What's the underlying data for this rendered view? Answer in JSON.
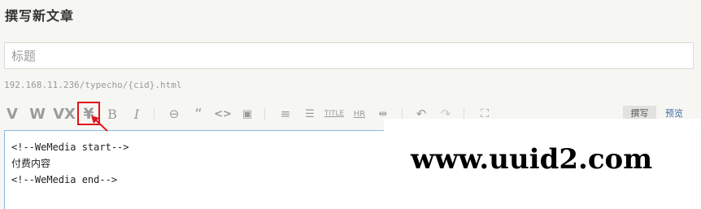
{
  "page": {
    "title": "撰写新文章"
  },
  "title_field": {
    "placeholder": "标题",
    "value": ""
  },
  "permalink": "192.168.11.236/typecho/{cid}.html",
  "toolbar": {
    "buttons": [
      {
        "glyph": "V",
        "icon": "v-plugin-icon"
      },
      {
        "glyph": "W",
        "icon": "w-plugin-icon"
      },
      {
        "glyph": "VX",
        "icon": "vx-plugin-icon"
      },
      {
        "glyph": "¥",
        "icon": "yuan-paid-content-icon"
      },
      {
        "glyph": "B",
        "icon": "bold-icon"
      },
      {
        "glyph": "I",
        "icon": "italic-icon"
      },
      {
        "glyph": "⊖",
        "icon": "link-icon"
      },
      {
        "glyph": "“",
        "icon": "quote-icon"
      },
      {
        "glyph": "<>",
        "icon": "code-icon"
      },
      {
        "glyph": "▣",
        "icon": "image-icon"
      },
      {
        "glyph": "≡",
        "icon": "ordered-list-icon"
      },
      {
        "glyph": "☰",
        "icon": "unordered-list-icon"
      },
      {
        "glyph": "TITLE",
        "icon": "heading-icon"
      },
      {
        "glyph": "HR",
        "icon": "horizontal-rule-icon"
      },
      {
        "glyph": "⇹",
        "icon": "more-separator-icon"
      },
      {
        "glyph": "↶",
        "icon": "undo-icon"
      },
      {
        "glyph": "↷",
        "icon": "redo-icon"
      },
      {
        "glyph": "⛶",
        "icon": "fullscreen-icon"
      }
    ],
    "tab_write": "撰写",
    "tab_preview": "预览"
  },
  "editor": {
    "lines": [
      "<!--WeMedia start-->",
      "付费内容",
      "<!--WeMedia end-->"
    ]
  },
  "watermark": "www.uuid2.com",
  "colors": {
    "highlight": "#e0141e",
    "preview_link": "#3d6fa6",
    "editor_border": "#8fb6e0"
  }
}
